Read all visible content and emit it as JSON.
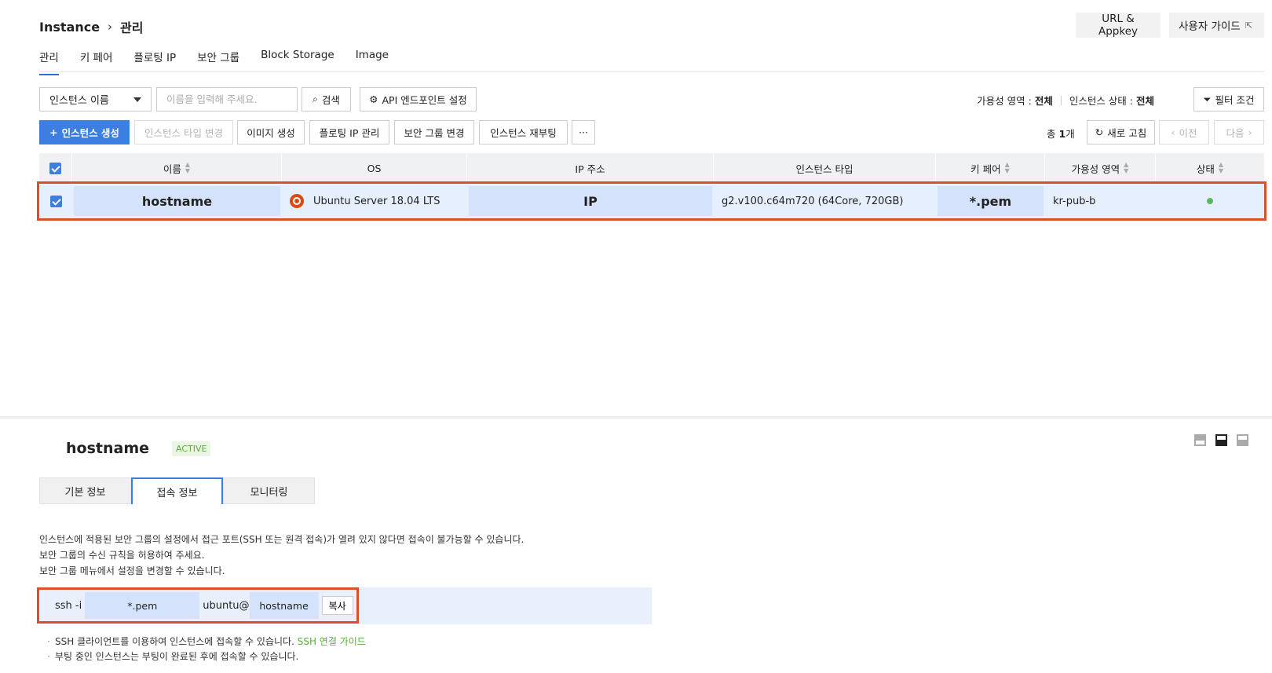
{
  "breadcrumb": {
    "root": "Instance",
    "current": "관리"
  },
  "header_buttons": {
    "url_appkey": "URL & Appkey",
    "user_guide": "사용자 가이드"
  },
  "tabs": [
    "관리",
    "키 페어",
    "플로팅 IP",
    "보안 그룹",
    "Block Storage",
    "Image"
  ],
  "search": {
    "select_value": "인스턴스 이름",
    "placeholder": "이름을 입력해 주세요.",
    "search_button": "검색",
    "api_button": "API 엔드포인트 설정"
  },
  "filters": {
    "zone_label": "가용성 영역 :",
    "zone_value": "전체",
    "status_label": "인스턴스 상태 :",
    "status_value": "전체",
    "filter_button": "필터 조건"
  },
  "actions": {
    "create": "인스턴스 생성",
    "change_type": "인스턴스 타입 변경",
    "create_image": "이미지 생성",
    "floating_ip": "플로팅 IP 관리",
    "security_group": "보안 그룹 변경",
    "reboot": "인스턴스 재부팅",
    "more": "···"
  },
  "pager": {
    "total_prefix": "총",
    "total_count": "1",
    "total_suffix": "개",
    "refresh": "새로 고침",
    "prev": "이전",
    "next": "다음"
  },
  "table": {
    "columns": [
      "이름",
      "OS",
      "IP 주소",
      "인스턴스 타입",
      "키 페어",
      "가용성 영역",
      "상태"
    ],
    "rows": [
      {
        "name": "hostname",
        "os": "Ubuntu Server 18.04 LTS",
        "ip": "IP",
        "type": "g2.v100.c64m720 (64Core, 720GB)",
        "keypair": "*.pem",
        "zone": "kr-pub-b",
        "status_color": "#5cb85c"
      }
    ]
  },
  "detail": {
    "title": "hostname",
    "status_badge": "ACTIVE",
    "tabs": [
      "기본 정보",
      "접속 정보",
      "모니터링"
    ],
    "messages": [
      "인스턴스에 적용된 보안 그룹의 설정에서 접근 포트(SSH 또는 원격 접속)가 열려 있지 않다면 접속이 불가능할 수 있습니다.",
      "보안 그룹의 수신 규칙을 허용하여 주세요.",
      "보안 그룹 메뉴에서 설정을 변경할 수 있습니다."
    ],
    "ssh": {
      "prefix": "ssh -i ",
      "pem": "*.pem",
      "user": "ubuntu@",
      "host": "hostname",
      "copy": "복사"
    },
    "notes": {
      "note1_text": "SSH 클라이언트를 이용하여 인스턴스에 접속할 수 있습니다.",
      "note1_link": "SSH 연결 가이드",
      "note2_text": "부팅 중인 인스턴스는 부팅이 완료된 후에 접속할 수 있습니다."
    }
  },
  "colors": {
    "accent": "#3d7ee1",
    "highlight_border": "#d9502c",
    "active_green": "#5cab3c"
  }
}
